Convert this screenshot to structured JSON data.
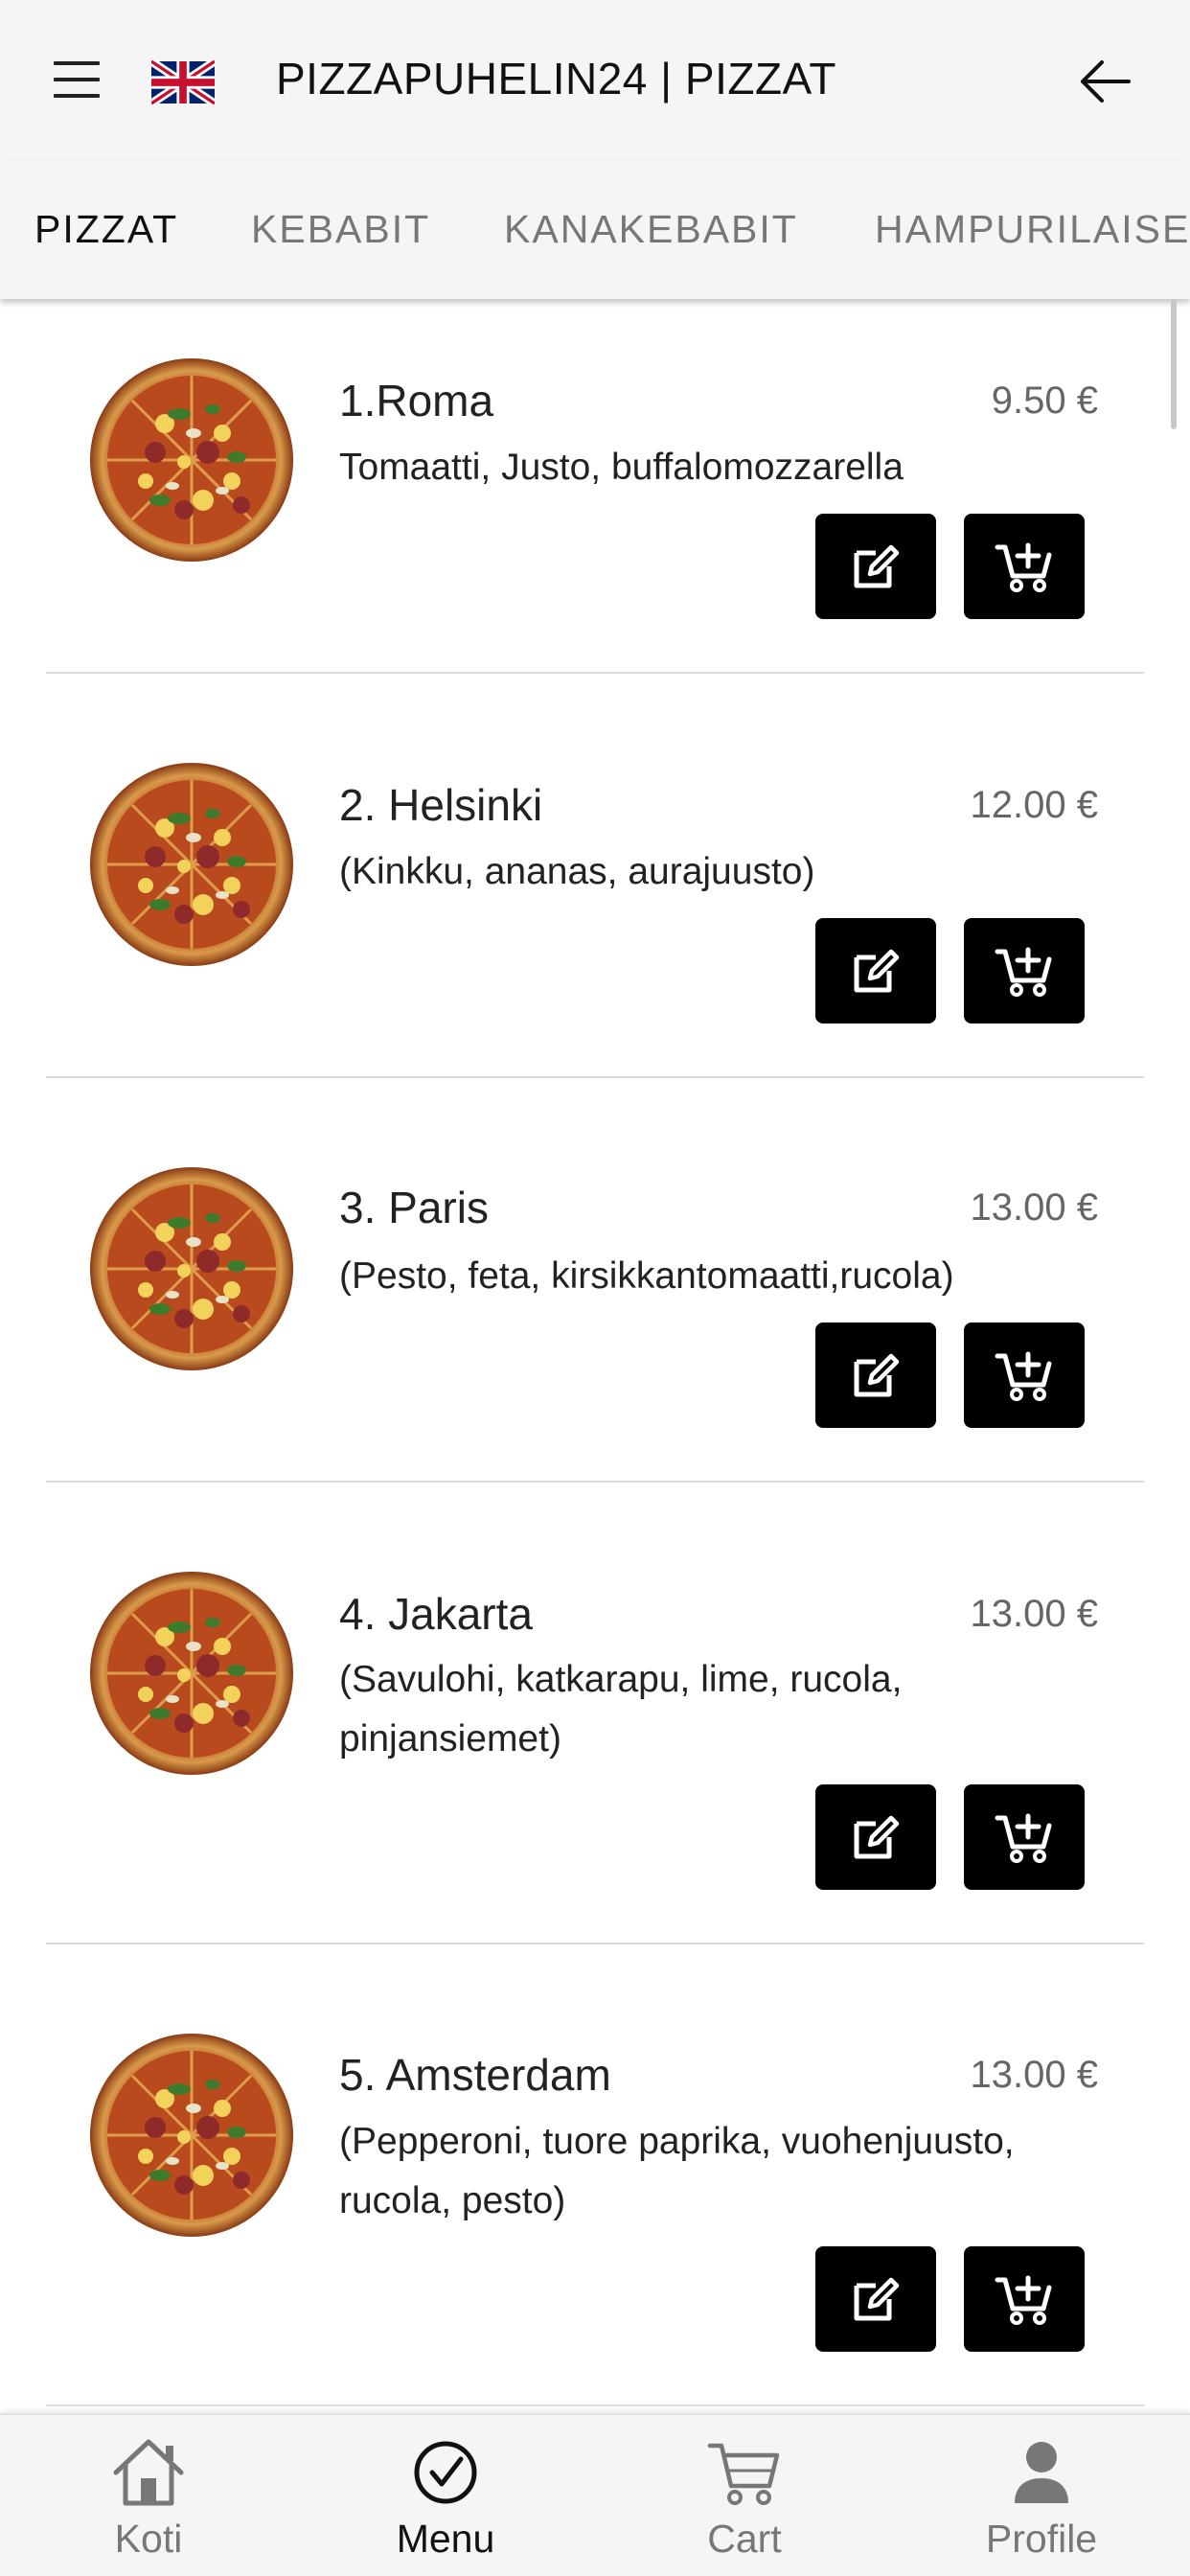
{
  "header": {
    "title": "PIZZAPUHELIN24 | PIZZAT",
    "language_icon": "uk-flag-icon",
    "menu_icon": "hamburger-menu-icon",
    "back_icon": "arrow-left-icon"
  },
  "tabs": [
    {
      "label": "PIZZAT",
      "active": true
    },
    {
      "label": "KEBABIT",
      "active": false
    },
    {
      "label": "KANAKEBABIT",
      "active": false
    },
    {
      "label": "HAMPURILAISET",
      "active": false
    }
  ],
  "items": [
    {
      "name": "1.Roma",
      "price": "9.50 €",
      "description": "Tomaatti, Justo, buffalomozzarella"
    },
    {
      "name": "2. Helsinki",
      "price": "12.00 €",
      "description": "(Kinkku, ananas, aurajuusto)"
    },
    {
      "name": "3. Paris",
      "price": "13.00 €",
      "description": "(Pesto, feta, kirsikkantomaatti,rucola)"
    },
    {
      "name": "4. Jakarta",
      "price": "13.00 €",
      "description": "(Savulohi, katkarapu, lime, rucola, pinjansiemet)"
    },
    {
      "name": "5. Amsterdam",
      "price": "13.00 €",
      "description": "(Pepperoni, tuore paprika, vuohenjuusto, rucola, pesto)"
    }
  ],
  "bottom_nav": [
    {
      "label": "Koti",
      "icon": "home-icon",
      "active": false
    },
    {
      "label": "Menu",
      "icon": "check-circle-icon",
      "active": true
    },
    {
      "label": "Cart",
      "icon": "cart-icon",
      "active": false
    },
    {
      "label": "Profile",
      "icon": "person-icon",
      "active": false
    }
  ],
  "colors": {
    "header_bg": "#f5f5f5",
    "button_bg": "#000000",
    "active_text": "#111111",
    "inactive_text": "#777777"
  }
}
